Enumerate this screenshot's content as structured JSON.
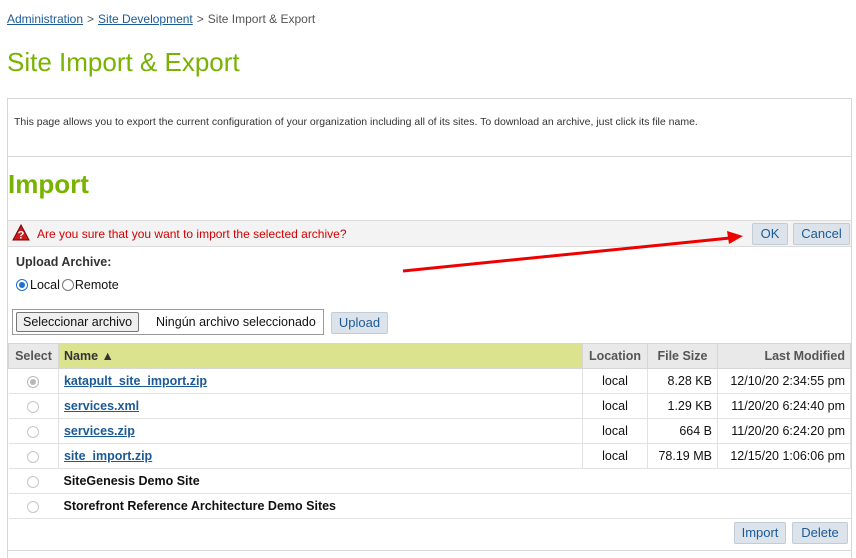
{
  "breadcrumb": {
    "items": [
      "Administration",
      "Site Development"
    ],
    "current": "Site Import & Export",
    "separator": ">"
  },
  "page_title": "Site Import & Export",
  "description": "This page allows you to export the current configuration of your organization including all of its sites. To download an archive, just click its file name.",
  "import_section": {
    "title": "Import",
    "confirm_message": "Are you sure that you want to import the selected archive?",
    "ok_label": "OK",
    "cancel_label": "Cancel",
    "upload_label": "Upload Archive:",
    "radio_local": "Local",
    "radio_remote": "Remote",
    "selected_source": "Local",
    "file_button_label": "Seleccionar archivo",
    "file_status": "Ningún archivo seleccionado",
    "upload_button_label": "Upload"
  },
  "table": {
    "headers": {
      "select": "Select",
      "name": "Name ▲",
      "location": "Location",
      "size": "File Size",
      "modified": "Last Modified"
    },
    "rows": [
      {
        "name": "katapult_site_import.zip",
        "location": "local",
        "size": "8.28 KB",
        "modified": "12/10/20 2:34:55 pm",
        "selected": true
      },
      {
        "name": "services.xml",
        "location": "local",
        "size": "1.29 KB",
        "modified": "11/20/20 6:24:40 pm",
        "selected": false
      },
      {
        "name": "services.zip",
        "location": "local",
        "size": "664 B",
        "modified": "11/20/20 6:24:20 pm",
        "selected": false
      },
      {
        "name": "site_import.zip",
        "location": "local",
        "size": "78.19 MB",
        "modified": "12/15/20 1:06:06 pm",
        "selected": false
      }
    ],
    "demo_rows": [
      {
        "name": "SiteGenesis Demo Site"
      },
      {
        "name": "Storefront Reference Architecture Demo Sites"
      }
    ]
  },
  "actions": {
    "import_label": "Import",
    "delete_label": "Delete"
  },
  "colors": {
    "title_green": "#77b300",
    "link_blue": "#1a5a96",
    "warning_red": "#d40000",
    "sorted_header": "#dce38f",
    "arrow_red": "#ee0000"
  },
  "icons": {
    "warning": "warning-icon",
    "annotation": "red-arrow-annotation"
  }
}
